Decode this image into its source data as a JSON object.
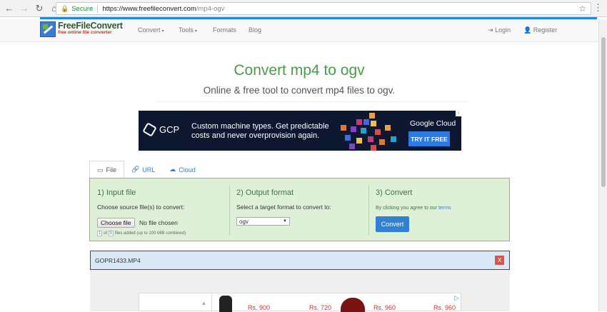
{
  "browser": {
    "secure_label": "Secure",
    "url_host": "https://www.freefileconvert.com",
    "url_path": "/mp4-ogv"
  },
  "header": {
    "logo_main": "FreeFileConvert",
    "logo_sub": "free online file converter",
    "nav": [
      {
        "label": "Convert",
        "caret": "▾"
      },
      {
        "label": "Tools",
        "caret": "▾"
      },
      {
        "label": "Formats"
      },
      {
        "label": "Blog"
      }
    ],
    "login": "Login",
    "register": "Register"
  },
  "hero": {
    "title": "Convert mp4 to ogv",
    "subtitle": "Online & free tool to convert mp4 files to ogv."
  },
  "ad": {
    "brand": "GCP",
    "line1": "Custom machine types. Get predictable",
    "line2": "costs and never overprovision again.",
    "cloud_label": "Google Cloud",
    "cta": "TRY IT FREE"
  },
  "tabs": [
    {
      "label": "File",
      "icon": "monitor-icon",
      "active": true
    },
    {
      "label": "URL",
      "icon": "link-icon"
    },
    {
      "label": "Cloud",
      "icon": "cloud-icon"
    }
  ],
  "steps": {
    "input": {
      "title": "1) Input file",
      "desc": "Choose source file(s) to convert:",
      "choose_label": "Choose file",
      "no_file": "No file chosen",
      "count_current": "1",
      "count_of": "of",
      "count_max": "5",
      "count_suffix": "files added (up to 100 MiB combined)"
    },
    "output": {
      "title": "2) Output format",
      "desc": "Select a target format to convert to:",
      "selected": "ogv"
    },
    "convert": {
      "title": "3) Convert",
      "agree_text": "By clicking you agree to our",
      "terms": "terms",
      "button": "Convert"
    }
  },
  "file_row": {
    "filename": "GOPR1433.MP4",
    "remove": "X"
  },
  "ad2": {
    "prices": [
      "Rs. 900",
      "Rs. 720",
      "Rs. 960",
      "Rs. 960"
    ]
  }
}
